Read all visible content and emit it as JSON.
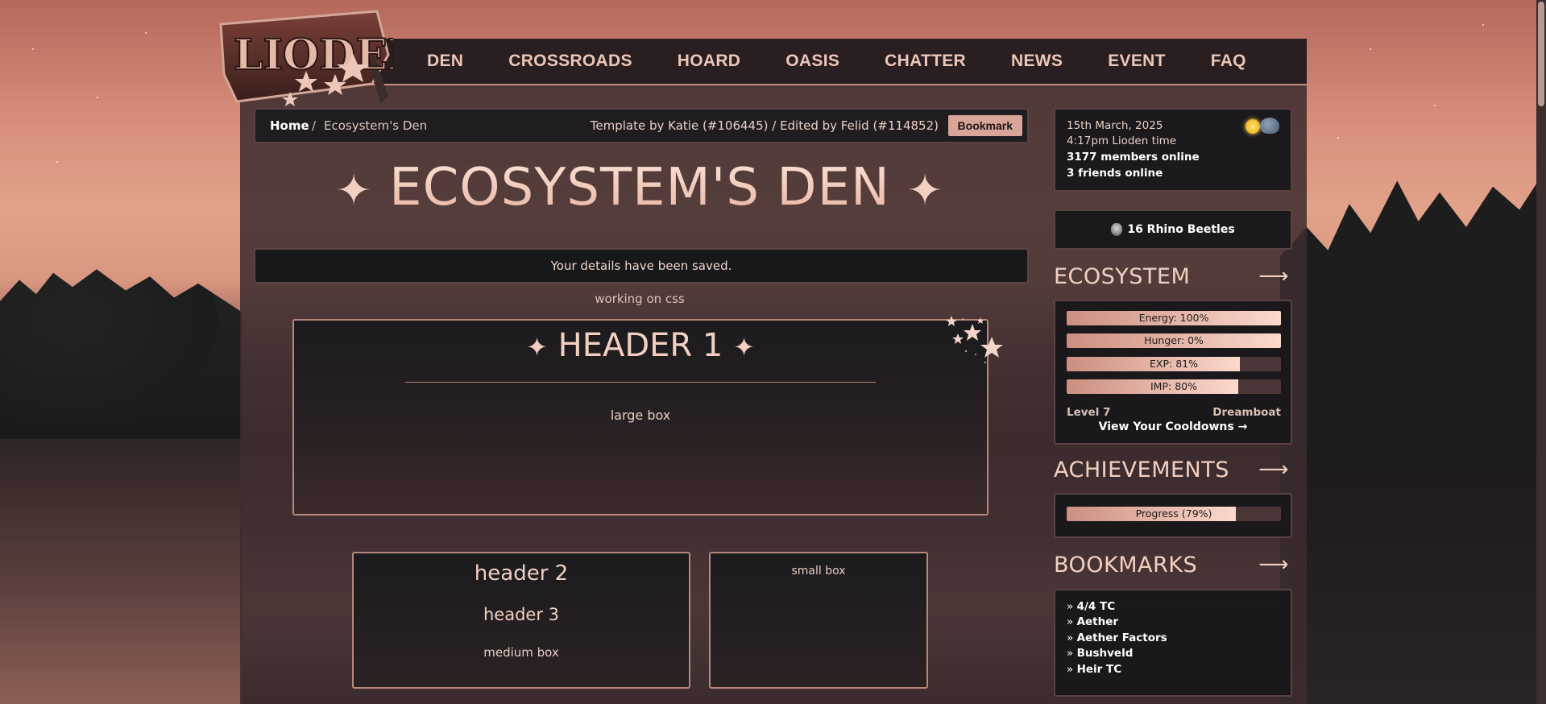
{
  "nav": {
    "items": [
      "DEN",
      "CROSSROADS",
      "HOARD",
      "OASIS",
      "CHATTER",
      "NEWS",
      "EVENT",
      "FAQ"
    ],
    "logo_text": "LIODEN"
  },
  "breadcrumb": {
    "home": "Home",
    "separator": "/",
    "current": "Ecosystem's Den",
    "credit": "Template by Katie (#106445) / Edited by Felid (#114852)",
    "bookmark": "Bookmark"
  },
  "page": {
    "title": "ECOSYSTEM'S DEN",
    "sparkle": "✦",
    "notice": "Your details have been saved.",
    "working": "working on css"
  },
  "boxes": {
    "header1": "HEADER 1",
    "large_label": "large box",
    "header2": "header 2",
    "header3": "header 3",
    "medium_label": "medium box",
    "small_label": "small box"
  },
  "sidebar": {
    "date": "15th March, 2025",
    "time": "4:17pm Lioden time",
    "members_online": "3177 members online",
    "friends_online": "3 friends online",
    "beetles": "16 Rhino Beetles",
    "ecosystem": {
      "title": "ECOSYSTEM",
      "arrow": "⟶",
      "energy": {
        "label": "Energy: 100%",
        "value": 100
      },
      "hunger": {
        "label": "Hunger: 0%",
        "value": 0
      },
      "exp": {
        "label": "EXP: 81%",
        "value": 81
      },
      "imp": {
        "label": "IMP: 80%",
        "value": 80
      },
      "level": "Level 7",
      "rank": "Dreamboat",
      "cooldowns": "View Your Cooldowns →"
    },
    "achievements": {
      "title": "ACHIEVEMENTS",
      "arrow": "⟶",
      "progress_label": "Progress (79%)",
      "progress_value": 79
    },
    "bookmarks": {
      "title": "BOOKMARKS",
      "arrow": "⟶",
      "bullet": "»",
      "items": [
        "4/4 TC",
        "Aether",
        "Aether Factors",
        "Bushveld",
        "Heir TC"
      ]
    }
  },
  "colors": {
    "accent": "#d9a599",
    "border": "#b7877b",
    "bar_fill_light": "#fbd9cc",
    "bar_fill_dark": "#cc8f80"
  }
}
